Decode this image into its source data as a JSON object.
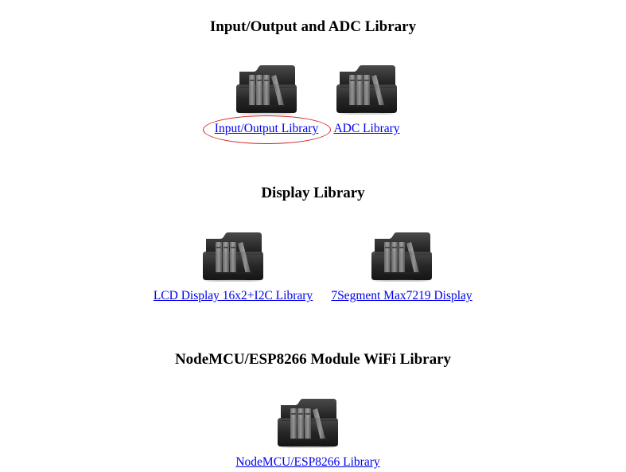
{
  "sections": [
    {
      "title": "Input/Output and ADC Library",
      "items": [
        {
          "label": "Input/Output Library",
          "icon": "library-folder-icon",
          "highlighted": true
        },
        {
          "label": "ADC Library",
          "icon": "library-folder-icon",
          "highlighted": false
        }
      ]
    },
    {
      "title": "Display Library",
      "items": [
        {
          "label": "LCD Display 16x2+I2C Library",
          "icon": "library-folder-icon",
          "highlighted": false
        },
        {
          "label": "7Segment Max7219 Display",
          "icon": "library-folder-icon",
          "highlighted": false
        }
      ]
    },
    {
      "title": "NodeMCU/ESP8266 Module WiFi Library",
      "items": [
        {
          "label": "NodeMCU/ESP8266 Library",
          "icon": "library-folder-icon",
          "highlighted": false
        }
      ]
    }
  ],
  "colors": {
    "link": "#0000ee",
    "highlight_ellipse": "#d42020",
    "folder": "#1b1b1b",
    "books": "#8a8a8a"
  }
}
